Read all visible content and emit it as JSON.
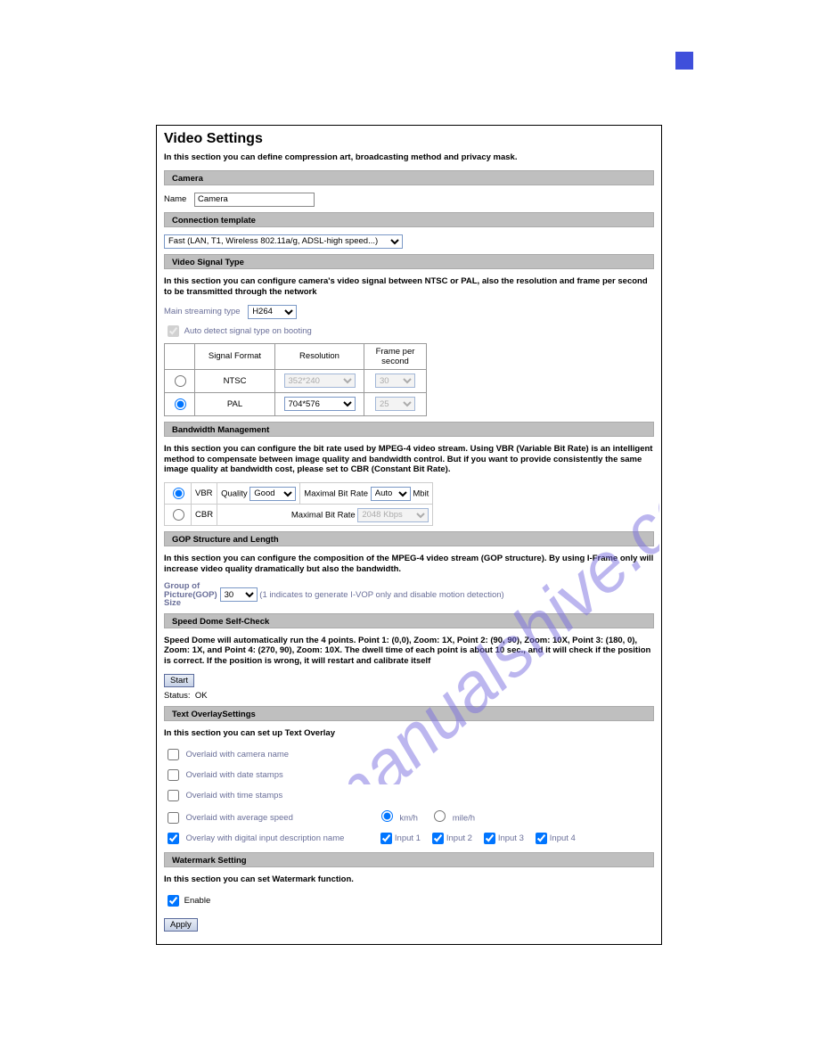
{
  "title": "Video Settings",
  "intro": "In this section you can define compression art, broadcasting method and privacy mask.",
  "camera": {
    "bar": "Camera",
    "name_label": "Name",
    "name_value": "Camera"
  },
  "conn": {
    "bar": "Connection template",
    "value": "Fast (LAN, T1, Wireless 802.11a/g, ADSL-high speed...)"
  },
  "signal": {
    "bar": "Video Signal Type",
    "desc": "In this section you can configure camera's video signal between NTSC or PAL, also the resolution and frame per second to be transmitted through the network",
    "main_label": "Main streaming type",
    "main_value": "H264",
    "autodetect": "Auto detect signal type on booting",
    "th_format": "Signal Format",
    "th_res": "Resolution",
    "th_fps": "Frame per second",
    "ntsc": "NTSC",
    "ntsc_res": "352*240",
    "ntsc_fps": "30",
    "pal": "PAL",
    "pal_res": "704*576",
    "pal_fps": "25"
  },
  "bw": {
    "bar": "Bandwidth Management",
    "desc": "In this section you can configure the bit rate used by MPEG-4 video stream. Using VBR (Variable Bit Rate) is an intelligent method to compensate between image quality and bandwidth control. But if you want to provide consistently the same image quality at bandwidth cost, please set to CBR (Constant Bit Rate).",
    "vbr": "VBR",
    "quality_label": "Quality",
    "quality_value": "Good",
    "max_label": "Maximal Bit Rate",
    "max_value": "Auto",
    "max_unit": "Mbit",
    "cbr": "CBR",
    "cbr_value": "2048 Kbps"
  },
  "gop": {
    "bar": "GOP Structure and Length",
    "desc": "In this section you can configure the composition of the MPEG-4 video stream (GOP structure). By using I-Frame only will increase video quality dramatically but also the bandwidth.",
    "label": "Group of Picture(GOP) Size",
    "value": "30",
    "note": "(1 indicates to generate I-VOP only and disable motion detection)"
  },
  "dome": {
    "bar": "Speed Dome Self-Check",
    "desc": "Speed Dome will automatically run the 4 points. Point 1: (0,0), Zoom: 1X, Point 2: (90, 90), Zoom: 10X, Point 3: (180, 0), Zoom: 1X, and Point 4: (270, 90), Zoom: 10X. The dwell time of each point is about 10 sec., and it will check if the position is correct. If the position is wrong, it will restart and calibrate itself",
    "start": "Start",
    "status_label": "Status:",
    "status_value": "OK"
  },
  "overlay": {
    "bar": "Text OverlaySettings",
    "desc": "In this section you can set up Text Overlay",
    "opt_camera": "Overlaid with camera name",
    "opt_date": "Overlaid with date stamps",
    "opt_time": "Overlaid with time stamps",
    "opt_speed": "Overlaid with average speed",
    "speed_kmh": "km/h",
    "speed_mileh": "mile/h",
    "opt_digital": "Overlay with digital input description name",
    "in1": "Input 1",
    "in2": "Input 2",
    "in3": "Input 3",
    "in4": "Input 4"
  },
  "wm": {
    "bar": "Watermark Setting",
    "desc": "In this section you can set Watermark function.",
    "enable": "Enable"
  },
  "apply": "Apply"
}
